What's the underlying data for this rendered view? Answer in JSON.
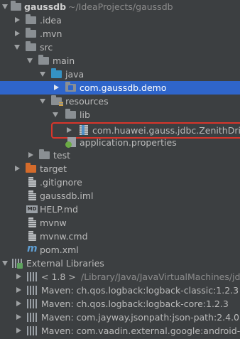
{
  "project_tree": {
    "root": {
      "name": "gaussdb",
      "path": "~/IdeaProjects/gaussdb"
    },
    "items": [
      {
        "label": ".idea"
      },
      {
        "label": ".mvn"
      },
      {
        "label": "src"
      },
      {
        "label": "main"
      },
      {
        "label": "java"
      },
      {
        "label": "com.gaussdb.demo",
        "selected": true
      },
      {
        "label": "resources"
      },
      {
        "label": "lib"
      },
      {
        "label": "com.huawei.gauss.jdbc.ZenithDri"
      },
      {
        "label": "application.properties"
      },
      {
        "label": "test"
      },
      {
        "label": "target"
      },
      {
        "label": ".gitignore"
      },
      {
        "label": "gaussdb.iml"
      },
      {
        "label": "HELP.md"
      },
      {
        "label": "mvnw"
      },
      {
        "label": "mvnw.cmd"
      },
      {
        "label": "pom.xml"
      },
      {
        "label": "External Libraries"
      },
      {
        "label": "< 1.8 >",
        "path": "/Library/Java/JavaVirtualMachines/jd"
      },
      {
        "label": "Maven: ch.qos.logback:logback-classic:1.2.3"
      },
      {
        "label": "Maven: ch.qos.logback:logback-core:1.2.3"
      },
      {
        "label": "Maven: com.jayway.jsonpath:json-path:2.4.0"
      },
      {
        "label": "Maven: com.vaadin.external.google:android-json"
      }
    ]
  },
  "icons": {
    "md_badge": "MD",
    "maven_glyph": "m"
  },
  "colors": {
    "background": "#3c3f41",
    "selection": "#2f65ca",
    "highlight_box": "#d9362b",
    "source_folder": "#3592c4",
    "excluded_folder": "#d46b2b"
  }
}
